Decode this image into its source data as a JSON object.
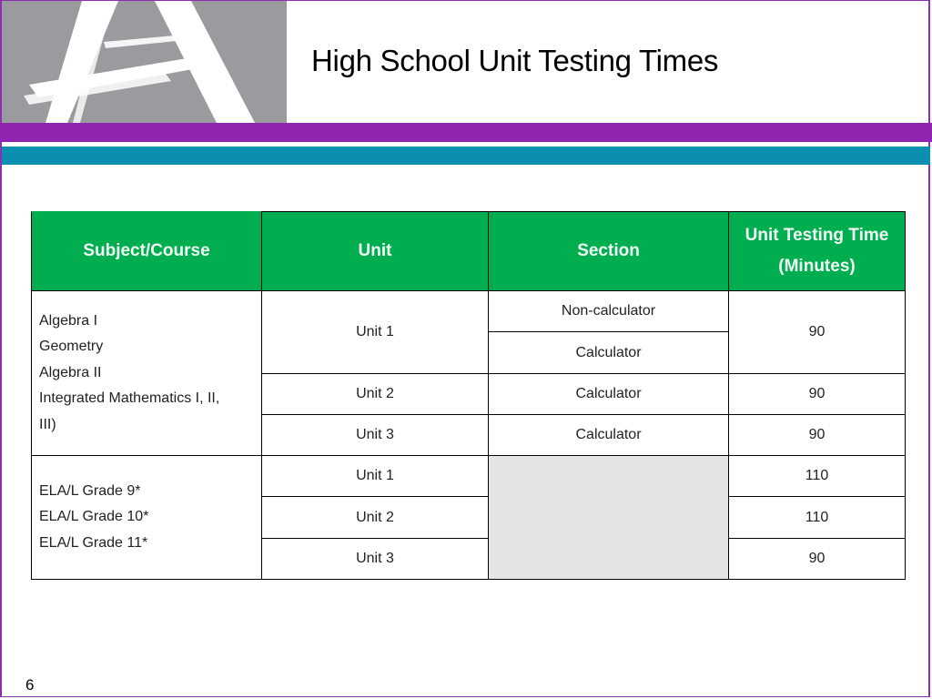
{
  "slide": {
    "title": "High School Unit Testing Times",
    "page_number": "6",
    "logo_icon": "brush-letter-a-logo",
    "colors": {
      "header_green": "#00ad4f",
      "band_purple": "#8e24b0",
      "band_teal": "#0b8fb0",
      "logo_gray": "#9a9b9f",
      "na_cell_gray": "#e4e4e4"
    }
  },
  "table": {
    "headers": [
      "Subject/Course",
      "Unit",
      "Section",
      "Unit Testing Time (Minutes)"
    ],
    "header_time_line1": "Unit Testing Time",
    "header_time_line2": "(Minutes)",
    "math_group": {
      "subjects": [
        "Algebra I",
        "Geometry",
        "Algebra II",
        "Integrated Mathematics I, II,",
        "III)"
      ],
      "rows": [
        {
          "unit": "Unit 1",
          "sections": [
            "Non-calculator",
            "Calculator"
          ],
          "time": "90"
        },
        {
          "unit": "Unit 2",
          "sections": [
            "Calculator"
          ],
          "time": "90"
        },
        {
          "unit": "Unit 3",
          "sections": [
            "Calculator"
          ],
          "time": "90"
        }
      ]
    },
    "ela_group": {
      "subjects": [
        "ELA/L Grade 9*",
        "ELA/L Grade 10*",
        "ELA/L Grade 11*"
      ],
      "rows": [
        {
          "unit": "Unit 1",
          "time": "110"
        },
        {
          "unit": "Unit 2",
          "time": "110"
        },
        {
          "unit": "Unit 3",
          "time": "90"
        }
      ]
    }
  }
}
